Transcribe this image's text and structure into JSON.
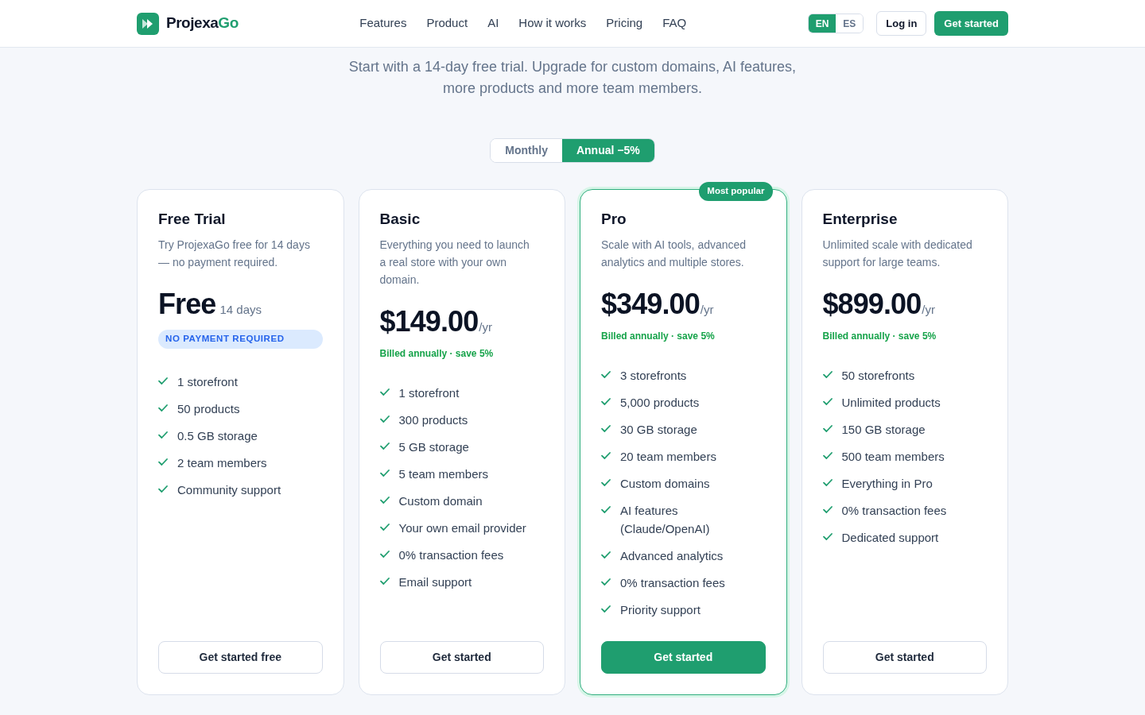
{
  "header": {
    "logo": {
      "name": "Projexa",
      "accent": "Go"
    },
    "nav": [
      "Features",
      "Product",
      "AI",
      "How it works",
      "Pricing",
      "FAQ"
    ],
    "languages": [
      {
        "label": "EN",
        "selected": true
      },
      {
        "label": "ES",
        "selected": false
      }
    ],
    "login_button": "Log in",
    "cta_button": "Get started"
  },
  "subtitle": "Start with a 14-day free trial. Upgrade for custom domains, AI features, more products and more team members.",
  "billing_toggle": [
    {
      "label": "Monthly",
      "selected": false
    },
    {
      "label": "Annual −5%",
      "selected": true
    }
  ],
  "plans": [
    {
      "name": "Free Trial",
      "description": "Try ProjexaGo free for 14 days — no payment required.",
      "featured": false,
      "price": "Free",
      "price_note": "14 days",
      "tag": "NO PAYMENT REQUIRED",
      "features": [
        "1 storefront",
        "50 products",
        "0.5 GB storage",
        "2 team members",
        "Community support"
      ],
      "button": "Get started free"
    },
    {
      "name": "Basic",
      "description": "Everything you need to launch a real store with your own domain.",
      "featured": false,
      "price": "$149.00",
      "price_suffix": "/yr",
      "billing_note": "Billed annually · save 5%",
      "features": [
        "1 storefront",
        "300 products",
        "5 GB storage",
        "5 team members",
        "Custom domain",
        "Your own email provider",
        "0% transaction fees",
        "Email support"
      ],
      "button": "Get started"
    },
    {
      "name": "Pro",
      "badge": "Most popular",
      "description": "Scale with AI tools, advanced analytics and multiple stores.",
      "featured": true,
      "price": "$349.00",
      "price_suffix": "/yr",
      "billing_note": "Billed annually · save 5%",
      "features": [
        "3 storefronts",
        "5,000 products",
        "30 GB storage",
        "20 team members",
        "Custom domains",
        "AI features (Claude/OpenAI)",
        "Advanced analytics",
        "0% transaction fees",
        "Priority support"
      ],
      "button": "Get started"
    },
    {
      "name": "Enterprise",
      "description": "Unlimited scale with dedicated support for large teams.",
      "featured": false,
      "price": "$899.00",
      "price_suffix": "/yr",
      "billing_note": "Billed annually · save 5%",
      "features": [
        "50 storefronts",
        "Unlimited products",
        "150 GB storage",
        "500 team members",
        "Everything in Pro",
        "0% transaction fees",
        "Dedicated support"
      ],
      "button": "Get started"
    }
  ]
}
